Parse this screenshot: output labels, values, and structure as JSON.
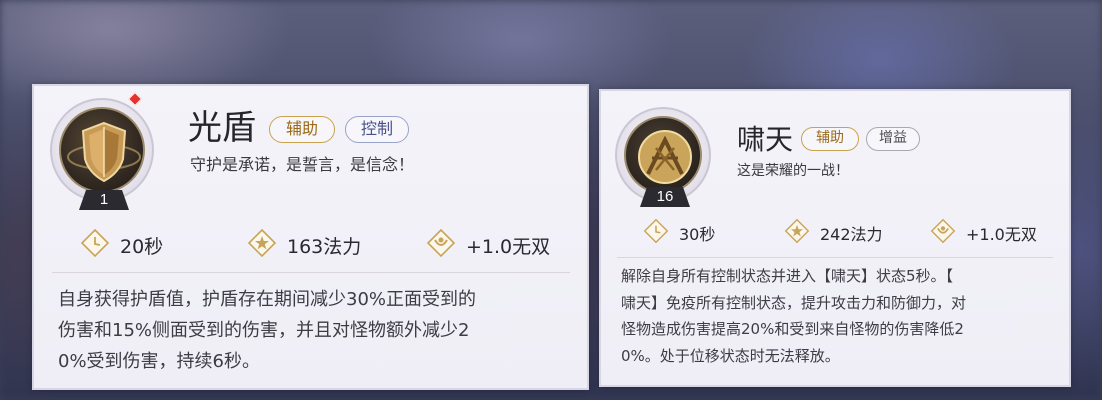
{
  "cards": [
    {
      "name": "光盾",
      "tags": [
        "辅助",
        "控制"
      ],
      "subtitle": "守护是承诺，是誓言，是信念！",
      "level": "1",
      "stats": {
        "cooldown": "20秒",
        "mana": "163法力",
        "bonus": "+1.0无双"
      },
      "description_lines": [
        "自身获得护盾值，护盾存在期间减少30%正面受到的",
        "伤害和15%侧面受到的伤害，并且对怪物额外减少2",
        "0%受到伤害，持续6秒。"
      ],
      "icon": "shield-emblem-icon"
    },
    {
      "name": "啸天",
      "tags": [
        "辅助",
        "增益"
      ],
      "subtitle": "这是荣耀的一战！",
      "level": "16",
      "stats": {
        "cooldown": "30秒",
        "mana": "242法力",
        "bonus": "+1.0无双"
      },
      "description_lines": [
        "解除自身所有控制状态并进入【啸天】状态5秒。【",
        "啸天】免疫所有控制状态，提升攻击力和防御力，对",
        "怪物造成伤害提高20%和受到来自怪物的伤害降低2",
        "0%。处于位移状态时无法释放。"
      ],
      "icon": "crossed-weapons-emblem-icon"
    }
  ],
  "colors": {
    "gold_tag": "#c9a24e",
    "blue_tag": "#9aa3c8",
    "icon_gold": "#c8a456",
    "new_indicator": "#e8302c"
  }
}
